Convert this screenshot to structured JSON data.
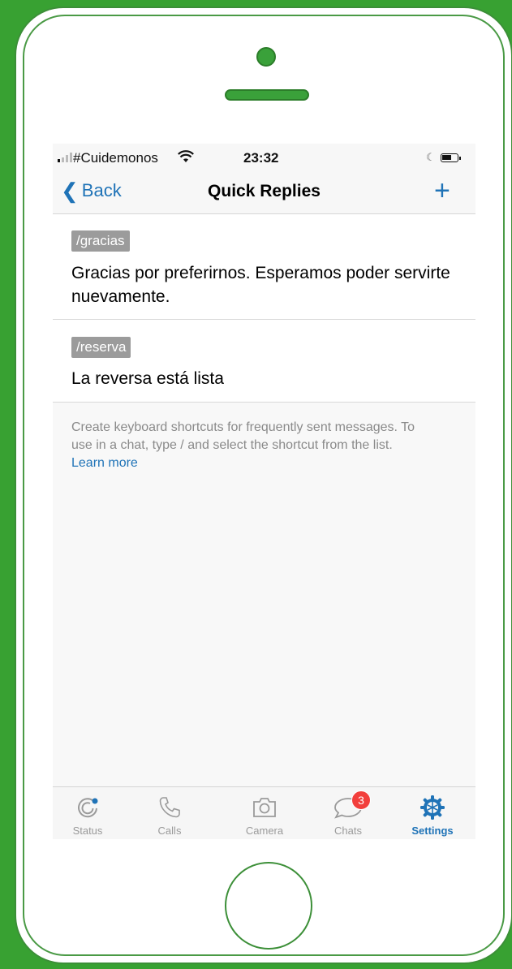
{
  "statusbar": {
    "carrier": "#Cuidemonos",
    "time": "23:32"
  },
  "navbar": {
    "back_label": "Back",
    "title": "Quick Replies",
    "add_label": "+"
  },
  "replies": [
    {
      "shortcut": "/gracias",
      "message": "Gracias por preferirnos. Esperamos poder servirte nuevamente."
    },
    {
      "shortcut": "/reserva",
      "message": "La reversa está lista"
    }
  ],
  "footer": {
    "note": "Create keyboard shortcuts for frequently sent messages. To use in a chat, type / and select the shortcut from the list.",
    "link": "Learn more"
  },
  "tabs": [
    {
      "label": "Status",
      "icon": "status-icon"
    },
    {
      "label": "Calls",
      "icon": "phone-icon"
    },
    {
      "label": "Camera",
      "icon": "camera-icon"
    },
    {
      "label": "Chats",
      "icon": "chat-bubble-icon",
      "badge": "3"
    },
    {
      "label": "Settings",
      "icon": "gear-icon",
      "active": true
    }
  ],
  "colors": {
    "accent": "#1f73b7",
    "background": "#38a132",
    "badge": "#f23f3c"
  }
}
